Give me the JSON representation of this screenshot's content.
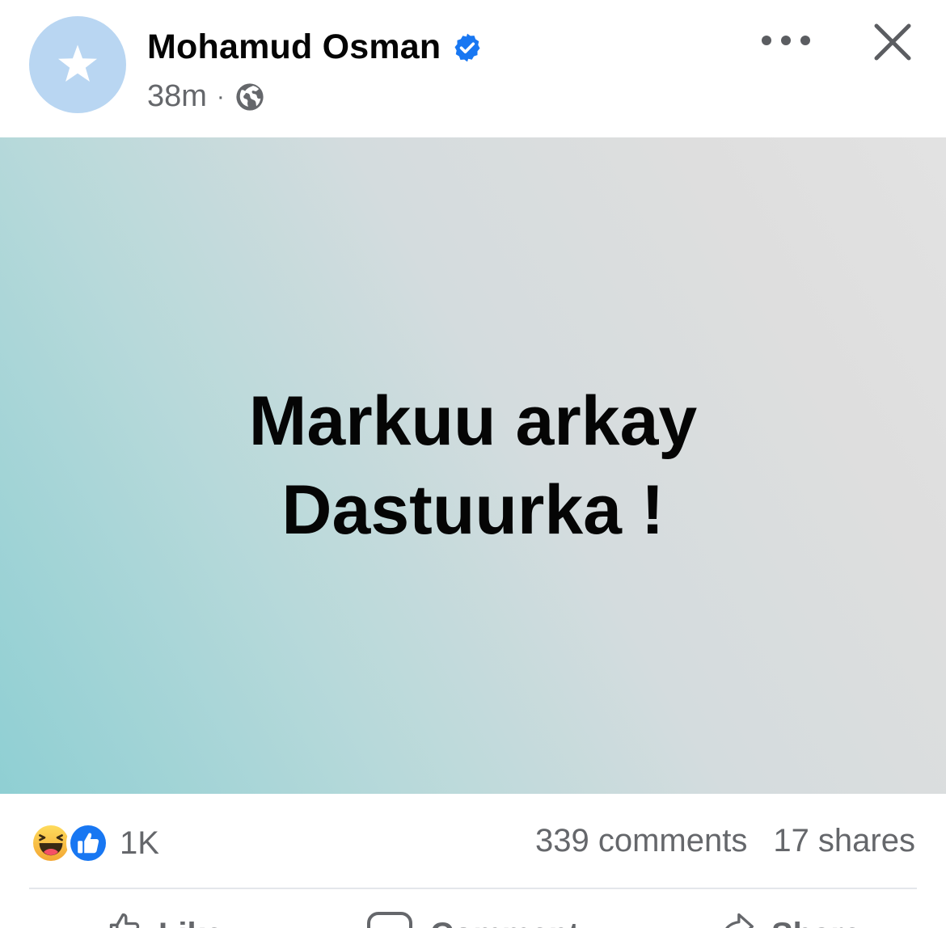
{
  "post": {
    "author": "Mohamud Osman",
    "timestamp": "38m",
    "separator": "·",
    "banner_line1": "Markuu arkay",
    "banner_line2": "Dastuurka !"
  },
  "engagement": {
    "reaction_count": "1K",
    "comments": "339 comments",
    "shares": "17 shares"
  },
  "actions": {
    "like_label": "Like",
    "comment_label": "Comment",
    "share_label": "Share"
  },
  "colors": {
    "verified_blue": "#1877f2",
    "secondary_text": "#65676b",
    "avatar_bg": "#b9d6f2",
    "banner_start": "#8fcfd3",
    "banner_end": "#e2e2e2"
  },
  "icons": {
    "avatar": "star-icon",
    "verified": "verified-badge-icon",
    "audience": "globe-icon",
    "more": "more-options-icon",
    "close": "close-icon",
    "reaction_haha": "haha-reaction-icon",
    "reaction_like": "like-reaction-icon"
  }
}
